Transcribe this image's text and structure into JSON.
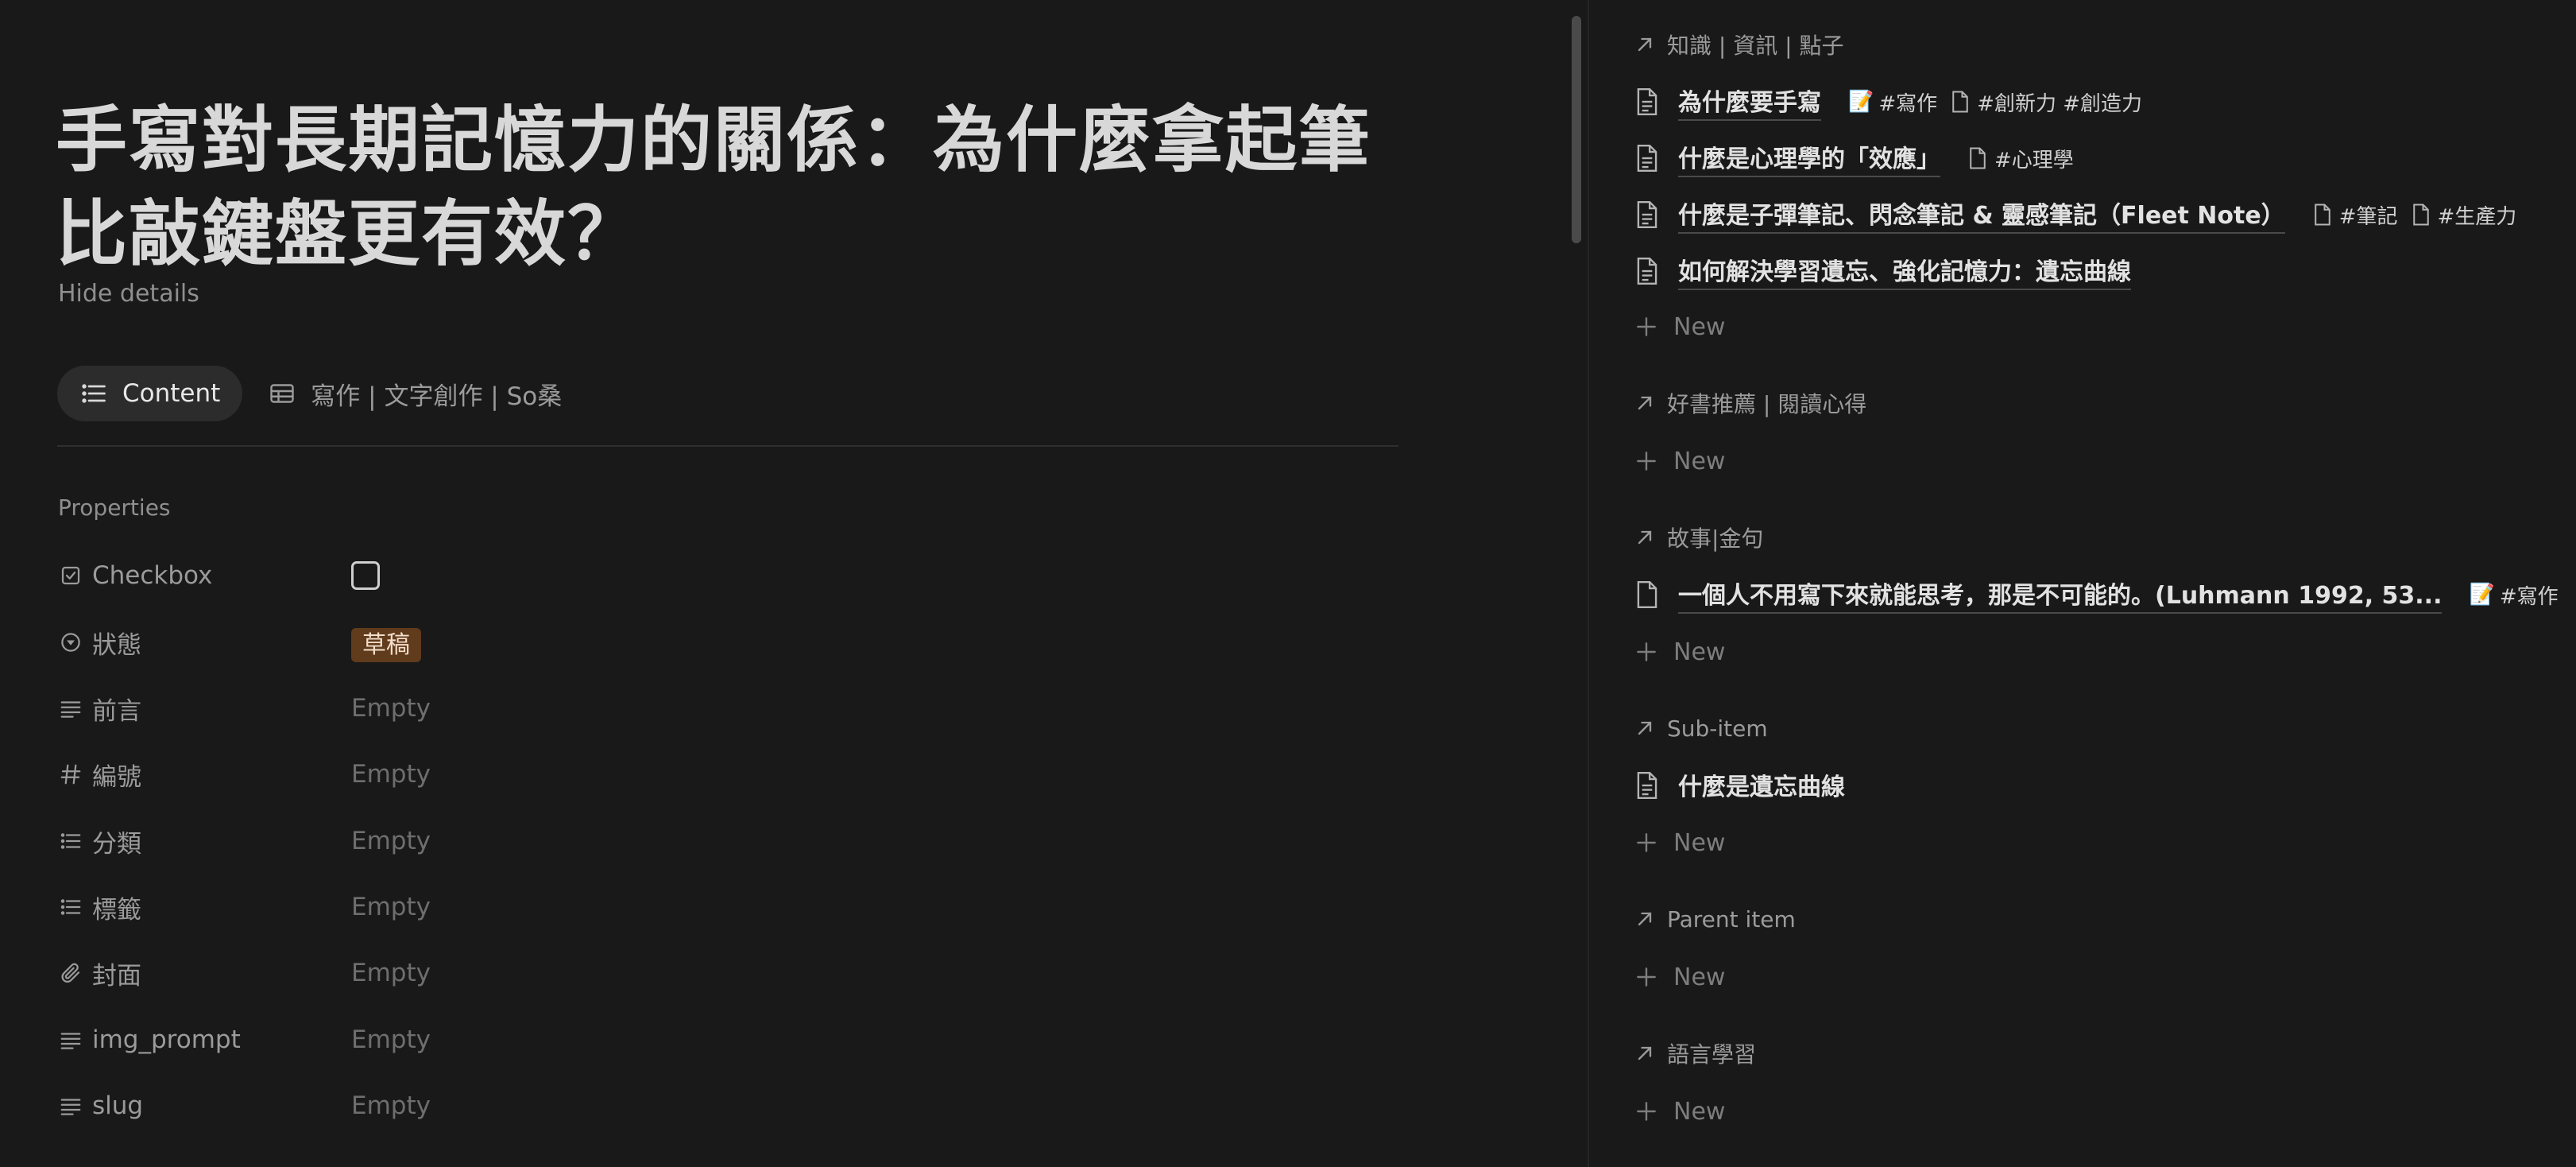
{
  "page": {
    "title": "手寫對長期記憶力的關係：為什麼拿起筆比敲鍵盤更有效？",
    "hide_details": "Hide details"
  },
  "tabs": [
    {
      "label": "Content",
      "icon": "list-icon",
      "active": true
    },
    {
      "label": "寫作 | 文字創作 | So桑",
      "icon": "table-icon",
      "active": false
    }
  ],
  "properties": {
    "heading": "Properties",
    "rows": [
      {
        "label": "Checkbox",
        "icon": "checkbox-icon",
        "value": ""
      },
      {
        "label": "狀態",
        "icon": "status-icon",
        "value": "草稿"
      },
      {
        "label": "前言",
        "icon": "text-icon",
        "value": "Empty"
      },
      {
        "label": "編號",
        "icon": "hash-icon",
        "value": "Empty"
      },
      {
        "label": "分類",
        "icon": "multi-select-icon",
        "value": "Empty"
      },
      {
        "label": "標籤",
        "icon": "multi-select-icon",
        "value": "Empty"
      },
      {
        "label": "封面",
        "icon": "paperclip-icon",
        "value": "Empty"
      },
      {
        "label": "img_prompt",
        "icon": "text-icon",
        "value": "Empty"
      },
      {
        "label": "slug",
        "icon": "text-icon",
        "value": "Empty"
      }
    ]
  },
  "relations": {
    "new_label": "New",
    "sections": [
      {
        "title": "知識 | 資訊 | 點子",
        "items": [
          {
            "name": "為什麼要手寫",
            "chips": [
              {
                "emoji": "📝",
                "text": "#寫作"
              },
              {
                "doc": true,
                "text": "#創新力 #創造力"
              }
            ]
          },
          {
            "name": "什麼是心理學的「效應」",
            "chips": [
              {
                "doc": true,
                "text": "#心理學"
              }
            ]
          },
          {
            "name": "什麼是子彈筆記、閃念筆記 & 靈感筆記（Fleet Note）",
            "chips": [
              {
                "doc": true,
                "text": "#筆記"
              },
              {
                "doc": true,
                "text": "#生產力"
              }
            ]
          },
          {
            "name": "如何解決學習遺忘、強化記憶力：遺忘曲線",
            "chips": []
          }
        ]
      },
      {
        "title": "好書推薦 | 閱讀心得",
        "items": []
      },
      {
        "title": "故事|金句",
        "items": [
          {
            "name": "一個人不用寫下來就能思考，那是不可能的。(Luhmann 1992, 53...",
            "chips": [
              {
                "emoji": "📝",
                "text": "#寫作"
              }
            ]
          }
        ]
      },
      {
        "title": "Sub-item",
        "items": [
          {
            "name": "什麼是遺忘曲線",
            "chips": []
          }
        ]
      },
      {
        "title": "Parent item",
        "items": []
      },
      {
        "title": "語言學習",
        "items": []
      }
    ]
  },
  "colors": {
    "background": "#191919",
    "status_tag_bg": "#603b1c",
    "status_tag_text": "#f3dfcb"
  }
}
